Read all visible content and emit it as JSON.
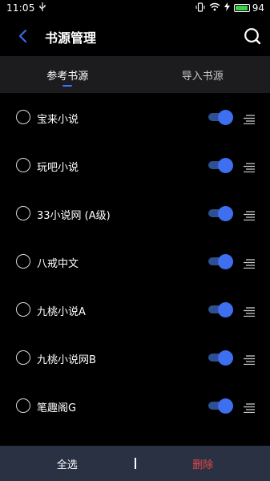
{
  "status_bar": {
    "time": "11:05",
    "battery_level": "94",
    "battery_fraction": 0.94,
    "icons": [
      "usb-icon",
      "vibrate-icon",
      "wifi-icon",
      "charging-icon",
      "battery-icon"
    ]
  },
  "header": {
    "title": "书源管理",
    "back_icon": "back-arrow-icon",
    "search_icon": "search-icon"
  },
  "tabs": [
    {
      "label": "参考书源",
      "active": true
    },
    {
      "label": "导入书源",
      "active": false
    }
  ],
  "sources": [
    {
      "name": "宝来小说",
      "selected": false,
      "enabled": true
    },
    {
      "name": "玩吧小说",
      "selected": false,
      "enabled": true
    },
    {
      "name": "33小说网 (A级)",
      "selected": false,
      "enabled": true
    },
    {
      "name": "八戒中文",
      "selected": false,
      "enabled": true
    },
    {
      "name": "九桃小说A",
      "selected": false,
      "enabled": true
    },
    {
      "name": "九桃小说网B",
      "selected": false,
      "enabled": true
    },
    {
      "name": "笔趣阁G",
      "selected": false,
      "enabled": true
    }
  ],
  "bottom_bar": {
    "select_all_label": "全选",
    "delete_label": "删除"
  },
  "colors": {
    "background": "#000000",
    "tab_bar": "#1c1c1e",
    "accent": "#3d6ff0",
    "toggle_track": "#2f4f93",
    "bottom_bar": "#2a3142",
    "delete": "#e6484a"
  }
}
